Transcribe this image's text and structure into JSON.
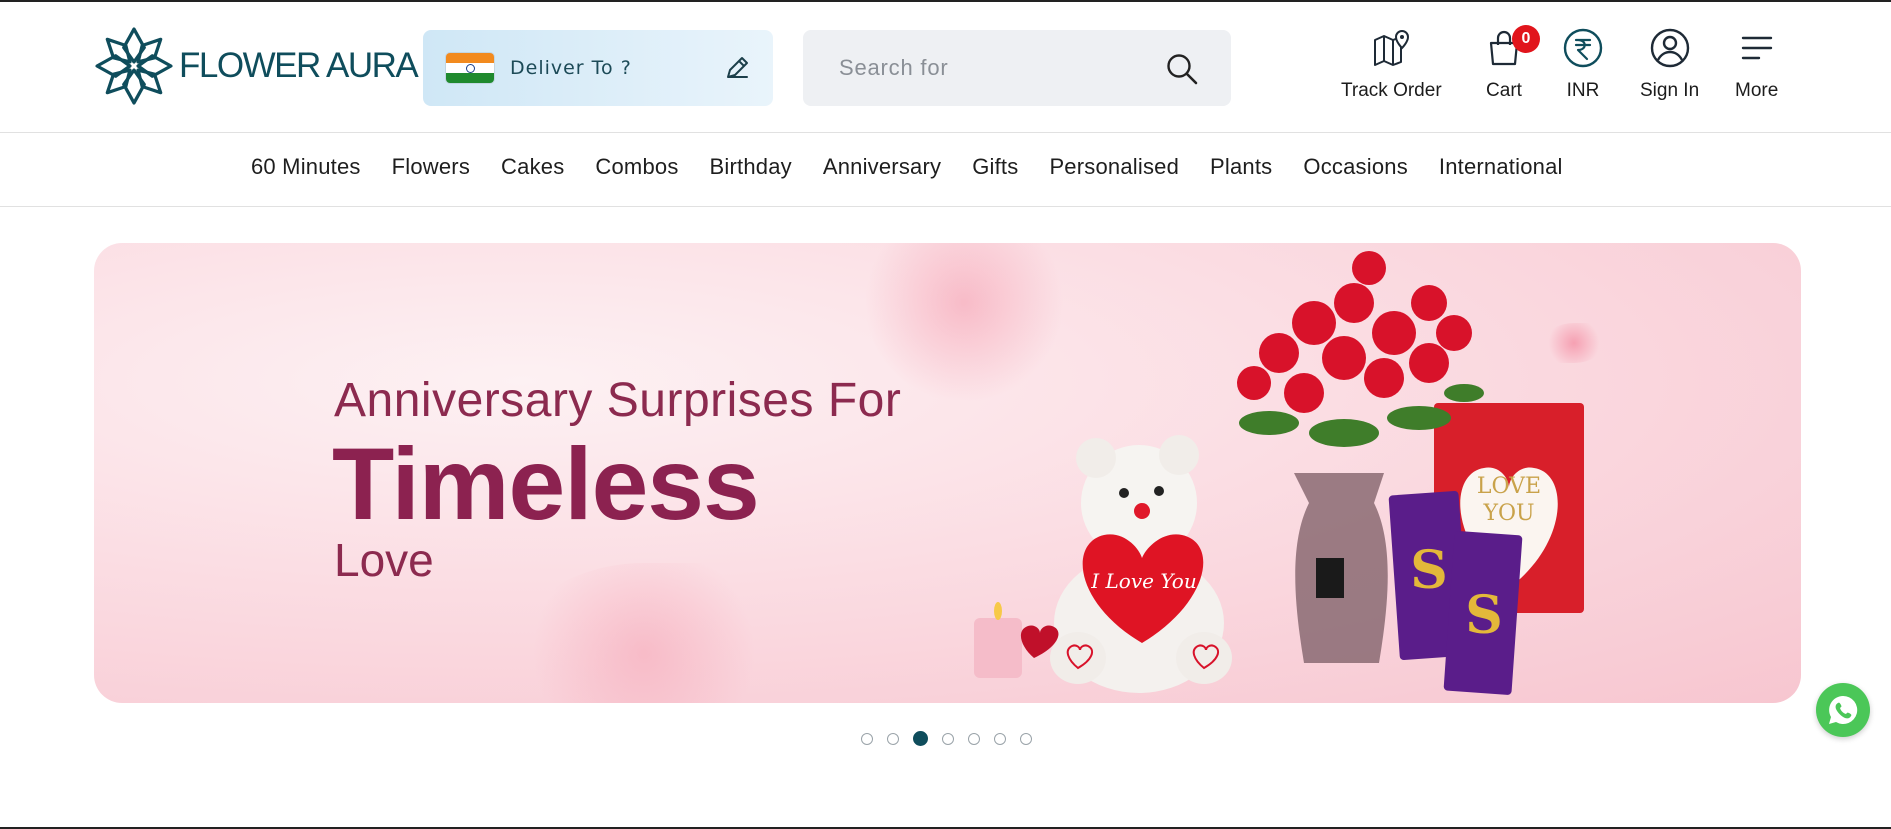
{
  "brand": {
    "name": "FLOWER AURA",
    "color": "#0f4d5c"
  },
  "deliver": {
    "label": "Deliver To ?",
    "flag_icon": "india-flag-icon",
    "edit_icon": "pencil-icon"
  },
  "search": {
    "placeholder": "Search for",
    "icon": "search-icon"
  },
  "actions": {
    "track_order": {
      "label": "Track Order",
      "icon": "map-pin-icon"
    },
    "cart": {
      "label": "Cart",
      "icon": "shopping-bag-icon",
      "count": "0"
    },
    "currency": {
      "label": "INR",
      "icon": "rupee-icon"
    },
    "sign_in": {
      "label": "Sign In",
      "icon": "user-icon"
    },
    "more": {
      "label": "More",
      "icon": "menu-icon"
    }
  },
  "menu": {
    "items": [
      "60 Minutes",
      "Flowers",
      "Cakes",
      "Combos",
      "Birthday",
      "Anniversary",
      "Gifts",
      "Personalised",
      "Plants",
      "Occasions",
      "International"
    ]
  },
  "banner": {
    "line1": "Anniversary Surprises For",
    "line2": "Timeless",
    "line3": "Love",
    "card_text": "LOVE YOU",
    "heart_text": "I Love You",
    "text_color": "#8c2250"
  },
  "carousel": {
    "total": 7,
    "active_index": 3
  },
  "whatsapp": {
    "icon": "whatsapp-icon",
    "color": "#4bc758"
  },
  "colors": {
    "badge": "#e1151c",
    "deliver_bg": "#cfe7f6",
    "search_bg": "#eef0f3"
  }
}
